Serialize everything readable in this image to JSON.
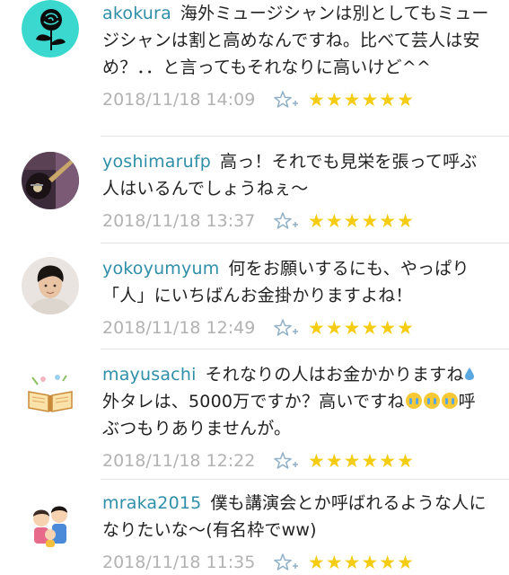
{
  "rating_stars": "★★★★★★",
  "colors": {
    "username": "#2f8fa8",
    "timestamp": "#b2b2b2",
    "star": "#f4cc12",
    "divider": "#e3e3e3"
  },
  "comments": [
    {
      "username": "akokura",
      "text": "海外ミュージシャンは別としてもミュージシャンは割と高めなんですね。比べて芸人は安め？．．と言ってもそれなりに高いけど^^",
      "timestamp": "2018/11/18 14:09",
      "avatar": "rose-icon"
    },
    {
      "username": "yoshimarufp",
      "text": "高っ！それでも見栄を張って呼ぶ人はいるんでしょうねぇ〜",
      "timestamp": "2018/11/18 13:37",
      "avatar": "guitar-photo"
    },
    {
      "username": "yokoyumyum",
      "text": "何をお願いするにも、やっぱり「人」にいちばんお金掛かりますよね！",
      "timestamp": "2018/11/18 12:49",
      "avatar": "person-photo"
    },
    {
      "username": "mayusachi",
      "text_part1": "それなりの人はお金かかりますね",
      "text_part2": "外タレは、5000万ですか？高いですね",
      "text_part3": "呼ぶつもりありませんが。",
      "timestamp": "2018/11/18 12:22",
      "avatar": "book-illustration"
    },
    {
      "username": "mraka2015",
      "text": "僕も講演会とか呼ばれるような人になりたいな〜(有名枠でww)",
      "timestamp": "2018/11/18 11:35",
      "avatar": "family-illustration"
    }
  ]
}
